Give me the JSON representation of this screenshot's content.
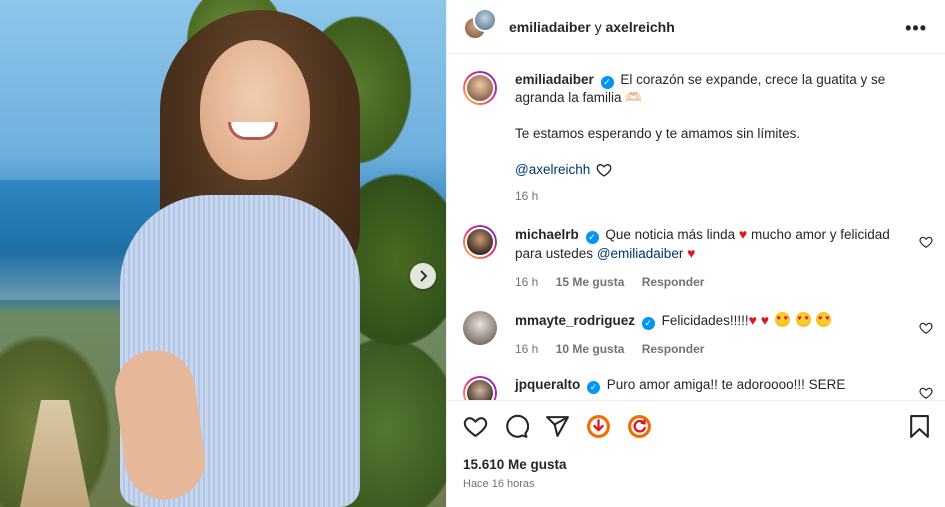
{
  "header": {
    "user1": "emiliadaiber",
    "separator": "y",
    "user2": "axelreichh",
    "more_label": "•••"
  },
  "caption": {
    "username": "emiliadaiber",
    "text_line1": "El corazón se expande, crece la guatita y se agranda la familia 🫶🏻",
    "text_line2": "Te estamos esperando y te amamos sin límites.",
    "tag": "@axelreichh",
    "time": "16 h"
  },
  "comments": [
    {
      "username": "michaelrb",
      "text_a": "Que noticia más linda",
      "text_b": "mucho amor y felicidad para ustedes",
      "mention": "@emiliadaiber",
      "time": "16 h",
      "likes": "15 Me gusta",
      "reply": "Responder"
    },
    {
      "username": "mmayte_rodriguez",
      "text": "Felicidades!!!!!",
      "time": "16 h",
      "likes": "10 Me gusta",
      "reply": "Responder"
    },
    {
      "username": "jpqueralto",
      "text": "Puro amor amiga!! te adoroooo!!! SERE"
    }
  ],
  "actions": {
    "icons": [
      "heart-icon",
      "comment-icon",
      "share-icon",
      "download-icon",
      "repost-icon",
      "bookmark-icon"
    ],
    "likes_count": "15.610 Me gusta",
    "time_ago": "Hace 16 horas"
  },
  "colors": {
    "accent_blue": "#0095f6",
    "mention_blue": "#00376b",
    "muted": "#737373",
    "heart_red": "#e0161e",
    "download_orange": "#f56a00"
  }
}
